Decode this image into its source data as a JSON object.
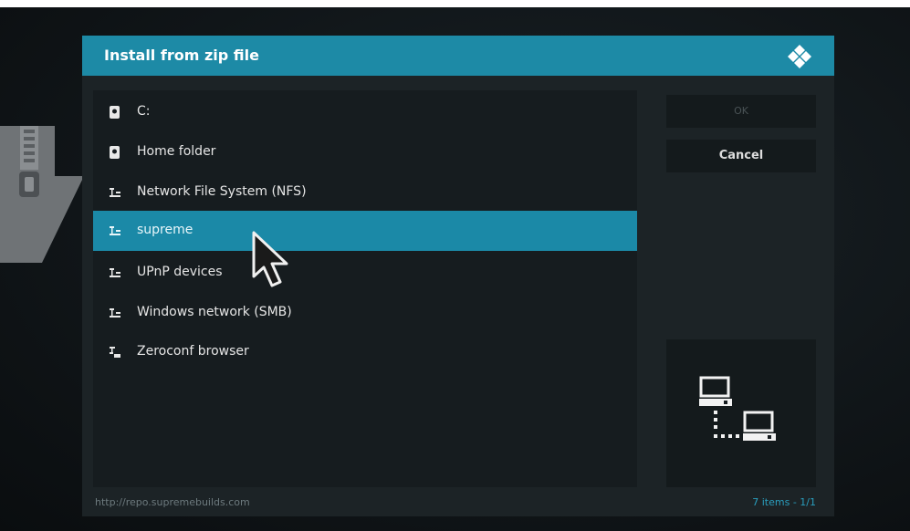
{
  "dialog": {
    "title": "Install from zip file"
  },
  "sources": [
    {
      "label": "C:",
      "icon": "drive-icon",
      "selected": false
    },
    {
      "label": "Home folder",
      "icon": "drive-icon",
      "selected": false
    },
    {
      "label": "Network File System (NFS)",
      "icon": "network-icon",
      "selected": false
    },
    {
      "label": "supreme",
      "icon": "network-icon",
      "selected": true
    },
    {
      "label": "UPnP devices",
      "icon": "network-icon",
      "selected": false
    },
    {
      "label": "Windows network (SMB)",
      "icon": "network-icon",
      "selected": false
    },
    {
      "label": "Zeroconf browser",
      "icon": "zeroconf-icon",
      "selected": false
    }
  ],
  "buttons": {
    "ok_label": "OK",
    "cancel_label": "Cancel"
  },
  "footer": {
    "path": "http://repo.supremebuilds.com",
    "count": "7 items - 1/1"
  },
  "colors": {
    "accent": "#1d8aa6",
    "selected_row": "#1b89a7",
    "panel": "#161c1f",
    "dialog_bg": "#1c2326"
  }
}
